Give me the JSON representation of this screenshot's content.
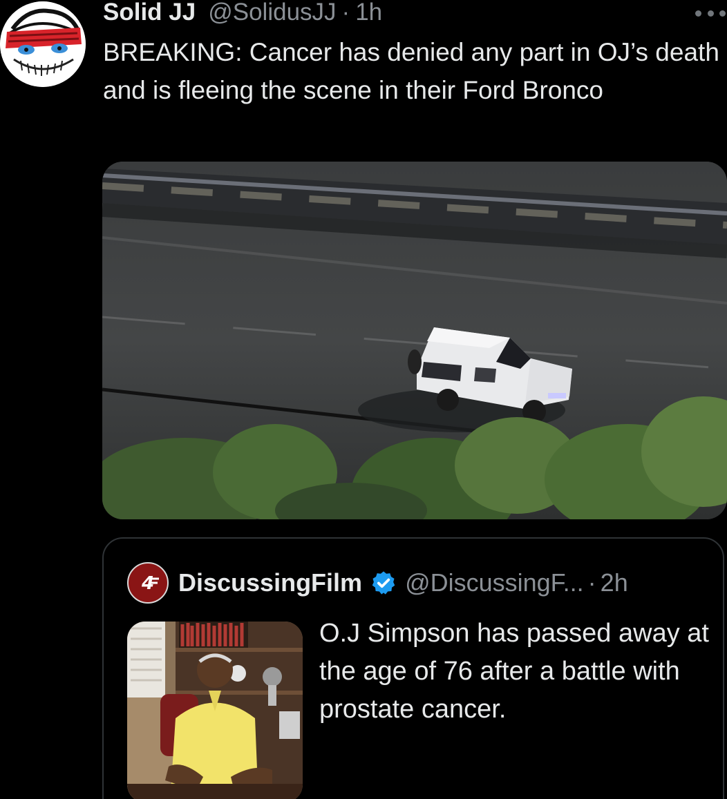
{
  "tweet": {
    "author": {
      "display_name": "Solid JJ",
      "handle": "@SolidusJJ",
      "separator": "·",
      "time": "1h",
      "avatar_icon": "sketch-face-avatar"
    },
    "more_icon": "more-dots-icon",
    "text": "BREAKING: Cancer has denied any part in OJ’s death and is fleeing the scene in their Ford Bronco",
    "media": {
      "kind": "photo",
      "description_icon": "white-bronco-highway-photo"
    }
  },
  "quote": {
    "author": {
      "display_name": "DiscussingFilm",
      "verified": true,
      "verified_color": "#1d9bf0",
      "handle": "@DiscussingF...",
      "separator": "·",
      "time": "2h",
      "avatar_icon": "discussingfilm-logo",
      "avatar_color": "#8a1515"
    },
    "text": "O.J Simpson has passed away at the age of 76 after a battle with prostate cancer.",
    "media": {
      "kind": "photo",
      "description_icon": "man-yellow-shirt-photo"
    }
  },
  "colors": {
    "background": "#000000",
    "primary_text": "#e7e9ea",
    "secondary_text": "#8b9096",
    "border": "#2f3336"
  }
}
